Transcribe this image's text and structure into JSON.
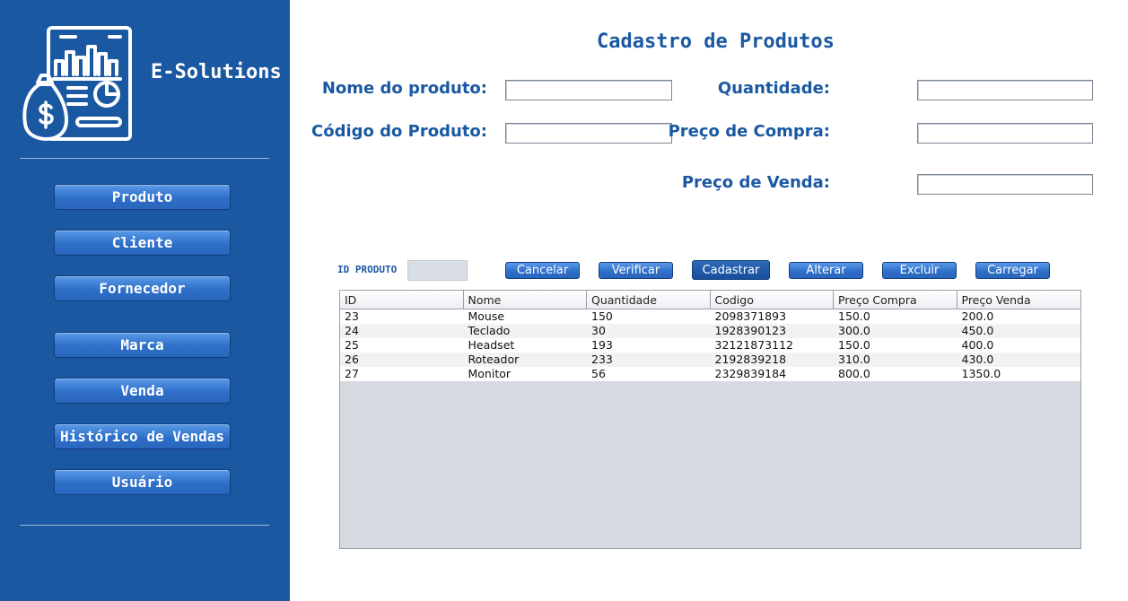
{
  "sidebar": {
    "brand": "E-Solutions",
    "logo_icon": "financial-report-icon",
    "nav": [
      {
        "label": "Produto"
      },
      {
        "label": "Cliente"
      },
      {
        "label": "Fornecedor"
      },
      {
        "label": "Marca"
      },
      {
        "label": "Venda"
      },
      {
        "label": "Histórico de Vendas"
      },
      {
        "label": "Usuário"
      }
    ]
  },
  "form": {
    "title": "Cadastro de Produtos",
    "nome_label": "Nome do produto:",
    "nome_value": "",
    "codigo_label": "Código do Produto:",
    "codigo_value": "",
    "quantidade_label": "Quantidade:",
    "quantidade_value": "",
    "preco_compra_label": "Preço de Compra:",
    "preco_compra_value": "",
    "preco_venda_label": "Preço de Venda:",
    "preco_venda_value": "",
    "id_label": "ID PRODUTO",
    "id_value": ""
  },
  "actions": {
    "cancelar": "Cancelar",
    "verificar": "Verificar",
    "cadastrar": "Cadastrar",
    "alterar": "Alterar",
    "excluir": "Excluir",
    "carregar": "Carregar"
  },
  "table": {
    "headers": [
      "ID",
      "Nome",
      "Quantidade",
      "Codigo",
      "Preço Compra",
      "Preço Venda"
    ],
    "rows": [
      [
        "23",
        "Mouse",
        "150",
        "2098371893",
        "150.0",
        "200.0"
      ],
      [
        "24",
        "Teclado",
        "30",
        "1928390123",
        "300.0",
        "450.0"
      ],
      [
        "25",
        "Headset",
        "193",
        "32121873112",
        "150.0",
        "400.0"
      ],
      [
        "26",
        "Roteador",
        "233",
        "2192839218",
        "310.0",
        "430.0"
      ],
      [
        "27",
        "Monitor",
        "56",
        "2329839184",
        "800.0",
        "1350.0"
      ]
    ]
  },
  "colors": {
    "sidebar_bg": "#1a58a2",
    "accent": "#1a58a2",
    "button": "#2e6fc9"
  }
}
